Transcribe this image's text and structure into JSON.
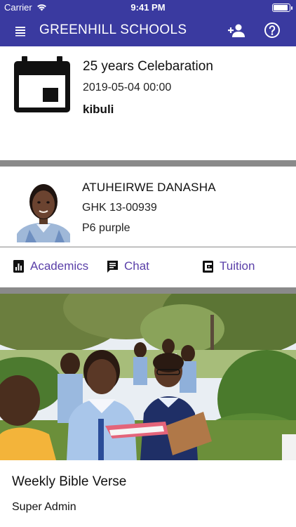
{
  "status_bar": {
    "carrier": "Carrier",
    "time": "9:41 PM",
    "battery_level": 0.95
  },
  "app_bar": {
    "title": "GREENHILL SCHOOLS",
    "icons": {
      "menu": "menu-icon",
      "add_user": "add-user-icon",
      "help": "help-icon"
    },
    "color": "#3a3aa0"
  },
  "event": {
    "icon": "calendar-icon",
    "title": "25 years Celebaration",
    "datetime": "2019-05-04 00:00",
    "location": "kibuli"
  },
  "student": {
    "name": "ATUHEIRWE DANASHA",
    "id": "GHK 13-00939",
    "class": "P6 purple"
  },
  "actions": [
    {
      "label": "Academics",
      "icon": "bar-chart-icon"
    },
    {
      "label": "Chat",
      "icon": "chat-icon"
    },
    {
      "label": "Tuition",
      "icon": "wallet-icon"
    }
  ],
  "post": {
    "title": "Weekly Bible Verse",
    "author": "Super Admin"
  },
  "colors": {
    "accent": "#5a3fa8",
    "separator": "#8a8a8a"
  }
}
